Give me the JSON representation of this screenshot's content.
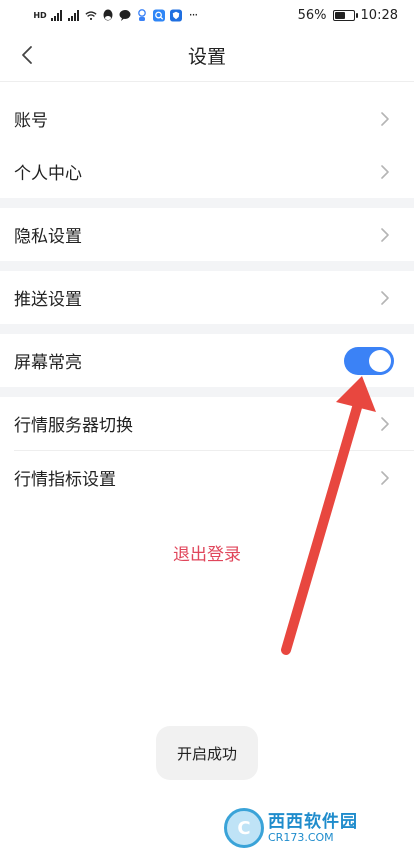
{
  "status_bar": {
    "left_icons": [
      "hd-icon",
      "signal-icon",
      "signal-icon",
      "wifi-icon",
      "qq-icon",
      "chat-icon",
      "baby-icon",
      "search-app-icon",
      "shield-app-icon",
      "more-icon"
    ],
    "battery_text": "56%",
    "battery_level": 0.56,
    "time": "10:28"
  },
  "header": {
    "title": "设置"
  },
  "menu": {
    "account": "账号",
    "personal_center": "个人中心",
    "privacy_settings": "隐私设置",
    "push_settings": "推送设置",
    "screen_always_on": "屏幕常亮",
    "quote_server_switch": "行情服务器切换",
    "quote_indicator_settings": "行情指标设置"
  },
  "toggle": {
    "screen_always_on": true
  },
  "logout": {
    "label": "退出登录"
  },
  "toast": {
    "message": "开启成功"
  },
  "watermark": {
    "logo_text": "西西软件园",
    "domain_text": "CR173.COM"
  },
  "colors": {
    "accent_blue": "#3b82f6",
    "logout_red": "#e0465b",
    "arrow_red": "#e8473f",
    "section_gap": "#f3f4f6",
    "chevron_gray": "#b5b5b5"
  }
}
